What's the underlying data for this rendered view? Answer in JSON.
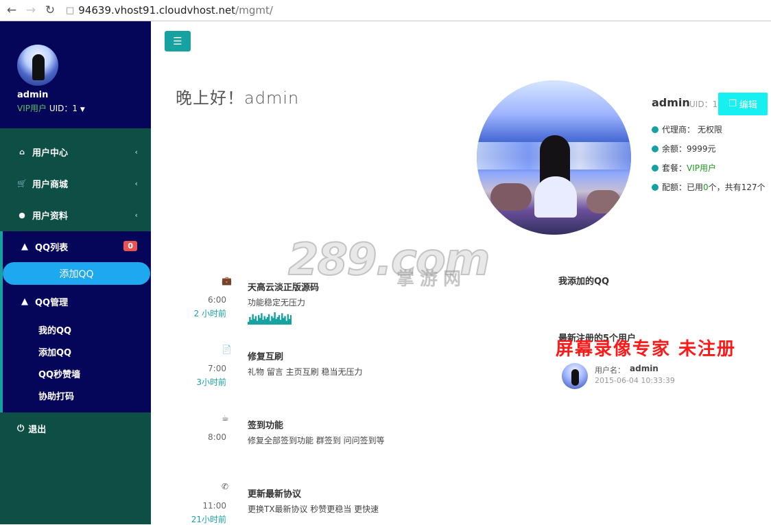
{
  "browser": {
    "back_icon": "back-arrow-icon",
    "forward_icon": "forward-arrow-icon",
    "reload_icon": "reload-icon",
    "url_domain": "94639.vhost91.cloudvhost.net",
    "url_path": "/mgmt/"
  },
  "sidebar": {
    "profile": {
      "name": "admin",
      "level": "VIP用户",
      "uid": " UID：1"
    },
    "menu": [
      {
        "label": "用户中心",
        "icon": "home-icon"
      },
      {
        "label": "用户商城",
        "icon": "cart-icon"
      },
      {
        "label": "用户资料",
        "icon": "user-icon"
      }
    ],
    "qq_list": {
      "label": "QQ列表",
      "badge": "0"
    },
    "add_qq_pill": "添加QQ",
    "qq_manage": {
      "label": "QQ管理"
    },
    "sub_links": [
      "我的QQ",
      "添加QQ",
      "QQ秒赞墙",
      "协助打码"
    ],
    "logout": "退出"
  },
  "main": {
    "greeting": "晚上好！admin",
    "user_card": {
      "name": "admin",
      "uid": "UID：1",
      "edit_label": "编辑",
      "rows": [
        {
          "label": "代理商：",
          "value": "无权限"
        },
        {
          "label": "余额：",
          "value": "9999元"
        },
        {
          "label": "套餐：",
          "value": "VIP用户"
        },
        {
          "label": "配额：",
          "pre": "已用",
          "used": "0",
          "mid": "个，共有",
          "total": "127",
          "post": "个"
        }
      ]
    },
    "timeline": [
      {
        "icon": "briefcase-icon",
        "time": "6:00",
        "ago": "2 小时前",
        "title": "天高云淡正版源码",
        "desc": "功能稳定无压力"
      },
      {
        "icon": "file-icon",
        "time": "7:00",
        "ago": "3小时前",
        "title": "修复互刷",
        "desc": "礼物 留言 主页互刷 稳当无压力"
      },
      {
        "icon": "coffee-icon",
        "time": "8:00",
        "ago": "",
        "title": "签到功能",
        "desc": "修复全部签到功能 群签到 问问签到等"
      },
      {
        "icon": "phone-icon",
        "time": "11:00",
        "ago": "21小时前",
        "title": "更新最新协议",
        "desc": "更换TX最新协议 秒赞更稳当 更快速"
      }
    ],
    "sparkline": [
      3,
      8,
      5,
      11,
      6,
      9,
      4,
      10,
      7,
      12,
      5,
      9,
      6,
      8,
      11,
      4,
      9,
      7,
      13,
      6,
      8,
      10,
      5,
      12,
      7,
      9,
      4,
      11,
      6,
      10
    ],
    "my_added_title": "我添加的QQ",
    "new_users_title": "最新注册的5个用户",
    "new_user": {
      "label": "用户名：",
      "name": "admin",
      "time": "2015-06-04 10:33:39"
    }
  },
  "watermark": {
    "logo": "289.com",
    "logo_sub": "掌游网",
    "recorder": "屏幕录像专家  未注册"
  },
  "colors": {
    "sidebar_profile_bg": "#05055a",
    "sidebar_bg": "#0d4f44",
    "accent_teal": "#17a2a2",
    "pill_blue": "#1da8ef",
    "edit_cyan": "#17f0f0",
    "badge_red": "#e85454",
    "vip_green": "#1e9a1e",
    "watermark_red": "#ff1a1a"
  }
}
